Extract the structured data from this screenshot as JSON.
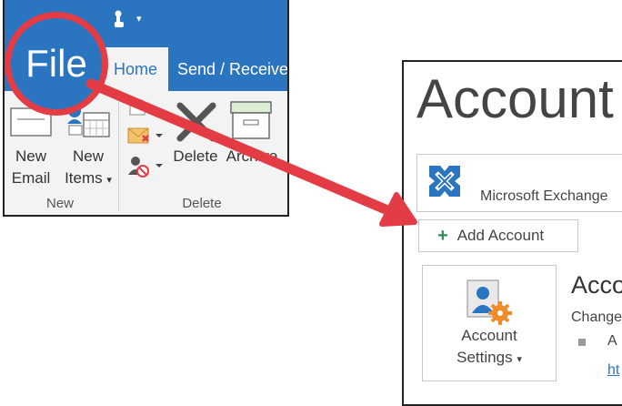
{
  "ribbon": {
    "file_label": "File",
    "tabs": [
      {
        "label": "Home",
        "active": true
      },
      {
        "label": "Send / Receive",
        "active": false
      }
    ],
    "new_group": {
      "label": "New",
      "new_email": {
        "line1": "New",
        "line2": "Email"
      },
      "new_items": {
        "line1": "New",
        "line2": "Items",
        "dropdown": "▾"
      }
    },
    "delete_group": {
      "label": "Delete",
      "delete_label": "Delete",
      "archive_label": "Archive"
    },
    "qat_dropdown": "▾"
  },
  "backstage": {
    "title": "Account",
    "exchange_label": "Microsoft Exchange",
    "add_account_label": "Add Account",
    "add_icon": "+",
    "account_settings": {
      "line1": "Account",
      "line2": "Settings",
      "dropdown": "▾"
    },
    "section_heading": "Acco",
    "section_sub": "Change",
    "bullet_text": "A",
    "link_text": "ht"
  },
  "colors": {
    "office_blue": "#2b74c0",
    "highlight_red": "#e43c45",
    "add_green": "#2e8b57"
  }
}
